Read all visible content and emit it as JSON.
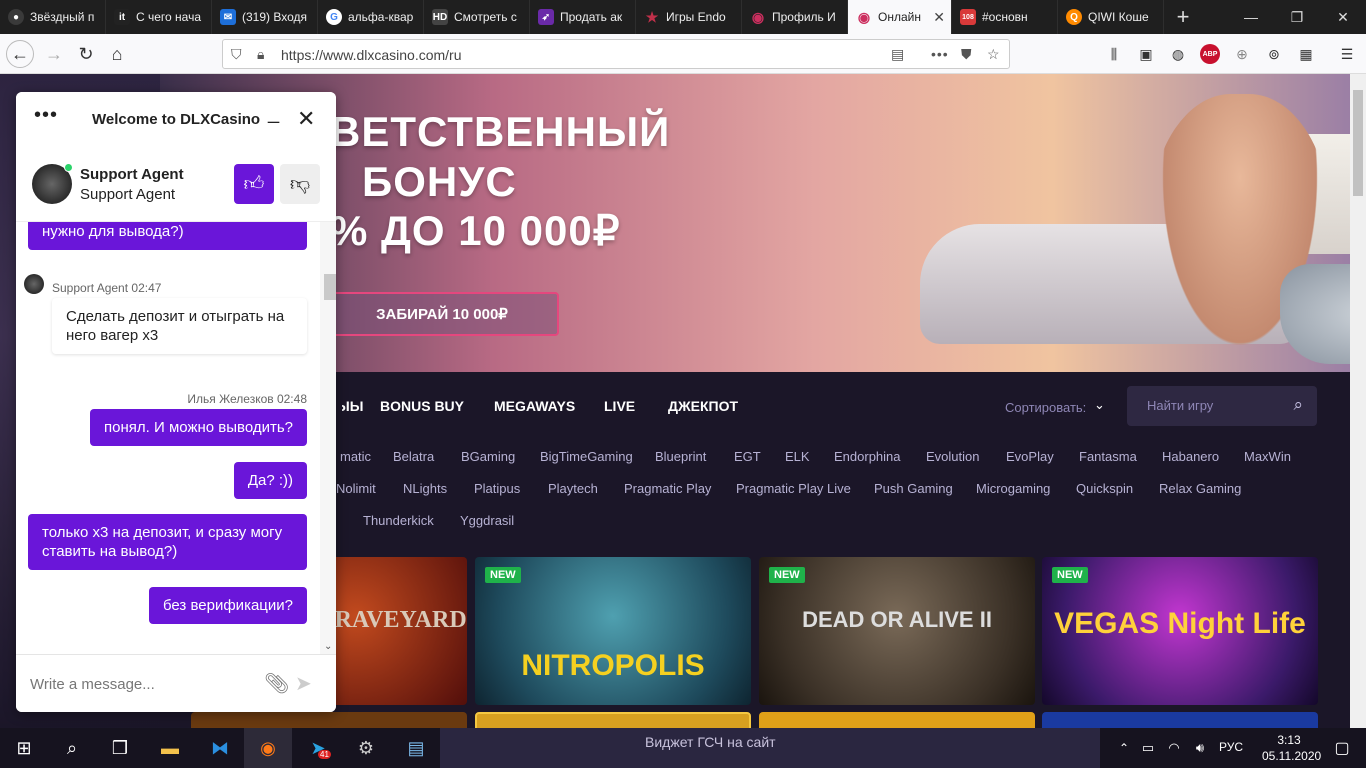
{
  "browser": {
    "tabs": [
      {
        "title": "Звёздный п",
        "color": "#3a3a3a"
      },
      {
        "title": "С чего нача",
        "color": "#222222"
      },
      {
        "title": "(319) Входя",
        "color": "#1e6fd9"
      },
      {
        "title": "альфа-квар",
        "color": "#4285f4"
      },
      {
        "title": "Смотреть с",
        "color": "#444444"
      },
      {
        "title": "Продать ак",
        "color": "#6a2aa8"
      },
      {
        "title": "Игры Endo",
        "color": "#c0304a"
      },
      {
        "title": "Профиль И",
        "color": "#cc2f5f"
      },
      {
        "title": "Онлайн",
        "color": "#cc2f5f"
      },
      {
        "title": "#основн",
        "color": "#d93a3a"
      },
      {
        "title": "QIWI Коше",
        "color": "#ff8a00"
      }
    ],
    "url": "https://www.dlxcasino.com/ru",
    "tab_badges": {
      "mail": "108"
    },
    "abp_label": "ABP"
  },
  "hero": {
    "line1": "ВЕТСТВЕННЫЙ",
    "line2": "БОНУС",
    "line3": "% ДО 10 000₽",
    "button": "ЗАБИРАЙ 10 000₽"
  },
  "categories": [
    "ЫЫ",
    "BONUS BUY",
    "MEGAWAYS",
    "LIVE",
    "ДЖЕКПОТ"
  ],
  "sort_label": "Сортировать:",
  "search_placeholder": "Найти игру",
  "providers_row1": [
    "matic",
    "Belatra",
    "BGaming",
    "BigTimeGaming",
    "Blueprint",
    "EGT",
    "ELK",
    "Endorphina",
    "Evolution",
    "EvoPlay",
    "Fantasma",
    "Habanero",
    "MaxWin"
  ],
  "providers_row2": [
    "Nolimit",
    "NLights",
    "Platipus",
    "Playtech",
    "Pragmatic Play",
    "Pragmatic Play Live",
    "Push Gaming",
    "Microgaming",
    "Quickspin",
    "Relax Gaming"
  ],
  "providers_row3": [
    "Thunderkick",
    "Yggdrasil"
  ],
  "games": [
    {
      "title": "WARRIOR GRAVEYARD",
      "new": false,
      "bg": "#6a1a12"
    },
    {
      "title": "NITROPOLIS",
      "new": true,
      "badge": "NEW",
      "bg": "#2d6a7c"
    },
    {
      "title": "DEAD OR ALIVE II",
      "new": true,
      "badge": "NEW",
      "bg": "#3a3026"
    },
    {
      "title": "VEGAS Night Life",
      "new": true,
      "badge": "NEW",
      "bg": "#3b1a6a"
    }
  ],
  "overlay_text": "Виджет ГСЧ на сайт",
  "chat": {
    "title": "Welcome to DLXCasino",
    "agent_name": "Support Agent",
    "agent_role": "Support Agent",
    "messages": [
      {
        "from": "user",
        "text": "нужно для вывода?)"
      },
      {
        "from": "agent",
        "meta": "Support Agent 02:47",
        "text": "Сделать депозит и отыграть на него вагер х3"
      },
      {
        "from": "user",
        "meta": "Илья Железков 02:48",
        "text": "понял. И можно выводить?"
      },
      {
        "from": "user",
        "text": "Да? :))"
      },
      {
        "from": "user",
        "text": "только х3 на депозит, и сразу могу ставить на вывод?)"
      },
      {
        "from": "user",
        "text": "без верификации?"
      }
    ],
    "input_placeholder": "Write a message..."
  },
  "taskbar": {
    "language": "РУС",
    "time": "3:13",
    "date": "05.11.2020",
    "telegram_badge": "41"
  }
}
